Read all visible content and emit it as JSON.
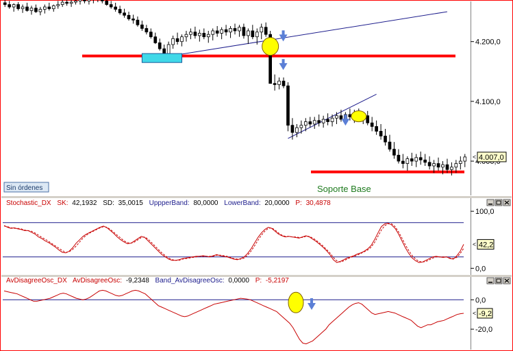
{
  "chart_data": [
    {
      "type": "candlestick",
      "panel": "price",
      "y_ticks": [
        "4.200,0",
        "4.100,0",
        "4.000,0"
      ],
      "y_tick_values": [
        4200,
        4100,
        4000
      ],
      "ylim": [
        3945,
        4265
      ],
      "last_value_label": "4.007,0",
      "last_value": 4007,
      "status_label": "Sin órdenes",
      "annotation_label": "Soporte Base",
      "support_levels": [
        4176,
        3982
      ],
      "colors": {
        "up": "#ffffff",
        "down": "#000000",
        "support": "#ff0000",
        "trend": "#1c1c8c",
        "highlight": "#ffff00",
        "marker": "#5b7fd6"
      },
      "candles": [
        [
          4265,
          4270,
          4258,
          4262
        ],
        [
          4262,
          4268,
          4255,
          4258
        ],
        [
          4258,
          4264,
          4250,
          4262
        ],
        [
          4262,
          4266,
          4252,
          4255
        ],
        [
          4255,
          4262,
          4248,
          4258
        ],
        [
          4258,
          4265,
          4250,
          4252
        ],
        [
          4252,
          4260,
          4245,
          4256
        ],
        [
          4256,
          4262,
          4248,
          4250
        ],
        [
          4250,
          4258,
          4244,
          4254
        ],
        [
          4254,
          4262,
          4247,
          4258
        ],
        [
          4258,
          4265,
          4252,
          4255
        ],
        [
          4255,
          4262,
          4250,
          4260
        ],
        [
          4260,
          4268,
          4255,
          4262
        ],
        [
          4262,
          4270,
          4258,
          4266
        ],
        [
          4266,
          4272,
          4260,
          4264
        ],
        [
          4264,
          4270,
          4258,
          4266
        ],
        [
          4266,
          4272,
          4262,
          4268
        ],
        [
          4268,
          4275,
          4262,
          4270
        ],
        [
          4270,
          4276,
          4264,
          4268
        ],
        [
          4268,
          4274,
          4262,
          4270
        ],
        [
          4270,
          4276,
          4264,
          4272
        ],
        [
          4272,
          4278,
          4266,
          4270
        ],
        [
          4270,
          4276,
          4264,
          4268
        ],
        [
          4268,
          4274,
          4260,
          4262
        ],
        [
          4262,
          4268,
          4255,
          4258
        ],
        [
          4258,
          4265,
          4250,
          4254
        ],
        [
          4254,
          4260,
          4245,
          4248
        ],
        [
          4248,
          4255,
          4240,
          4244
        ],
        [
          4244,
          4250,
          4235,
          4238
        ],
        [
          4238,
          4245,
          4230,
          4236
        ],
        [
          4236,
          4242,
          4225,
          4228
        ],
        [
          4228,
          4235,
          4218,
          4222
        ],
        [
          4222,
          4228,
          4212,
          4216
        ],
        [
          4216,
          4222,
          4205,
          4208
        ],
        [
          4208,
          4215,
          4196,
          4198
        ],
        [
          4198,
          4205,
          4185,
          4188
        ],
        [
          4188,
          4195,
          4172,
          4180
        ],
        [
          4180,
          4200,
          4176,
          4195
        ],
        [
          4195,
          4210,
          4188,
          4205
        ],
        [
          4205,
          4215,
          4195,
          4200
        ],
        [
          4200,
          4212,
          4192,
          4208
        ],
        [
          4208,
          4218,
          4200,
          4212
        ],
        [
          4212,
          4222,
          4204,
          4216
        ],
        [
          4216,
          4225,
          4205,
          4210
        ],
        [
          4210,
          4220,
          4200,
          4214
        ],
        [
          4214,
          4222,
          4204,
          4208
        ],
        [
          4208,
          4218,
          4198,
          4212
        ],
        [
          4212,
          4222,
          4202,
          4218
        ],
        [
          4218,
          4226,
          4208,
          4214
        ],
        [
          4214,
          4224,
          4204,
          4220
        ],
        [
          4220,
          4228,
          4210,
          4216
        ],
        [
          4216,
          4226,
          4206,
          4222
        ],
        [
          4222,
          4230,
          4212,
          4218
        ],
        [
          4218,
          4228,
          4208,
          4224
        ],
        [
          4224,
          4230,
          4205,
          4210
        ],
        [
          4210,
          4222,
          4196,
          4218
        ],
        [
          4218,
          4228,
          4204,
          4208
        ],
        [
          4208,
          4222,
          4195,
          4216
        ],
        [
          4216,
          4230,
          4204,
          4224
        ],
        [
          4224,
          4232,
          4208,
          4212
        ],
        [
          4212,
          4218,
          4160,
          4130
        ],
        [
          4130,
          4145,
          4118,
          4128
        ],
        [
          4128,
          4140,
          4120,
          4134
        ],
        [
          4134,
          4140,
          4122,
          4126
        ],
        [
          4126,
          4132,
          4050,
          4060
        ],
        [
          4060,
          4072,
          4036,
          4048
        ],
        [
          4048,
          4062,
          4040,
          4056
        ],
        [
          4056,
          4068,
          4046,
          4060
        ],
        [
          4060,
          4072,
          4050,
          4066
        ],
        [
          4066,
          4074,
          4056,
          4062
        ],
        [
          4062,
          4074,
          4054,
          4068
        ],
        [
          4068,
          4078,
          4058,
          4064
        ],
        [
          4064,
          4076,
          4056,
          4070
        ],
        [
          4070,
          4080,
          4060,
          4066
        ],
        [
          4066,
          4078,
          4058,
          4072
        ],
        [
          4072,
          4082,
          4062,
          4076
        ],
        [
          4076,
          4086,
          4066,
          4070
        ],
        [
          4070,
          4082,
          4062,
          4078
        ],
        [
          4078,
          4088,
          4068,
          4074
        ],
        [
          4074,
          4086,
          4064,
          4080
        ],
        [
          4080,
          4088,
          4068,
          4072
        ],
        [
          4072,
          4082,
          4062,
          4076
        ],
        [
          4076,
          4084,
          4060,
          4064
        ],
        [
          4064,
          4074,
          4050,
          4058
        ],
        [
          4058,
          4068,
          4044,
          4050
        ],
        [
          4050,
          4062,
          4036,
          4042
        ],
        [
          4042,
          4054,
          4026,
          4032
        ],
        [
          4032,
          4044,
          4016,
          4020
        ],
        [
          4020,
          4032,
          4004,
          4010
        ],
        [
          4010,
          4020,
          3996,
          4000
        ],
        [
          4000,
          4012,
          3988,
          3996
        ],
        [
          3996,
          4008,
          3984,
          4004
        ],
        [
          4004,
          4014,
          3992,
          4000
        ],
        [
          4000,
          4012,
          3990,
          4006
        ],
        [
          4006,
          4016,
          3994,
          4002
        ],
        [
          4002,
          4012,
          3992,
          3998
        ],
        [
          3998,
          4008,
          3986,
          3992
        ],
        [
          3992,
          4002,
          3980,
          3996
        ],
        [
          3996,
          4006,
          3984,
          3990
        ],
        [
          3990,
          4000,
          3978,
          3994
        ],
        [
          3994,
          4004,
          3980,
          3986
        ],
        [
          3986,
          3998,
          3976,
          3990
        ],
        [
          3990,
          4002,
          3980,
          3996
        ],
        [
          3996,
          4008,
          3986,
          4000
        ],
        [
          4000,
          4012,
          3990,
          4007
        ]
      ]
    },
    {
      "type": "line",
      "panel": "stochastic",
      "header": {
        "name": "Stochastic_DX",
        "sk_label": "SK:",
        "sk_value": "42,1932",
        "sd_label": "SD:",
        "sd_value": "35,0015",
        "upper_label": "UppperBand:",
        "upper_value": "80,0000",
        "lower_label": "LowerBand:",
        "lower_value": "20,0000",
        "p_label": "P:",
        "p_value": "30,4878"
      },
      "y_ticks": [
        "100,0",
        "0,0"
      ],
      "y_tick_values": [
        100,
        0
      ],
      "ylim": [
        -8,
        105
      ],
      "bands": [
        80,
        20
      ],
      "last_value_label": "42,2",
      "colors": {
        "sk": "#c80000",
        "sd": "#c80000",
        "band": "#1c1c8c"
      },
      "series": [
        {
          "name": "SK",
          "values": [
            75,
            72,
            70,
            71,
            69,
            68,
            66,
            66,
            63,
            60,
            55,
            52,
            48,
            45,
            41,
            37,
            32,
            28,
            27,
            30,
            36,
            44,
            50,
            56,
            60,
            63,
            66,
            69,
            72,
            74,
            71,
            66,
            61,
            55,
            50,
            46,
            43,
            44,
            48,
            52,
            56,
            54,
            48,
            42,
            36,
            30,
            24,
            20,
            16,
            14,
            14,
            15,
            17,
            18,
            19,
            20,
            21,
            21,
            22,
            21,
            20,
            22,
            24,
            22,
            21,
            20,
            18,
            16,
            15,
            17,
            20,
            26,
            34,
            44,
            54,
            62,
            68,
            72,
            70,
            65,
            60,
            57,
            55,
            56,
            55,
            54,
            53,
            55,
            57,
            55,
            51,
            47,
            42,
            37,
            31,
            24,
            15,
            10,
            12,
            15,
            18,
            20,
            22,
            25,
            27,
            30,
            34,
            40,
            50,
            62,
            73,
            78,
            79,
            76,
            70,
            60,
            48,
            36,
            26,
            18,
            13,
            10,
            11,
            14,
            17,
            20,
            21,
            20,
            19,
            20,
            17,
            16,
            22,
            30,
            42
          ]
        },
        {
          "name": "SD",
          "values": [
            74,
            73,
            71,
            70,
            70,
            69,
            67,
            66,
            65,
            62,
            58,
            54,
            51,
            47,
            43,
            39,
            35,
            31,
            28,
            29,
            33,
            39,
            46,
            53,
            58,
            62,
            65,
            68,
            71,
            73,
            72,
            68,
            63,
            58,
            53,
            48,
            45,
            44,
            46,
            50,
            54,
            55,
            51,
            45,
            39,
            33,
            27,
            22,
            18,
            15,
            14,
            14,
            16,
            17,
            18,
            19,
            20,
            21,
            21,
            21,
            21,
            21,
            23,
            23,
            22,
            21,
            19,
            17,
            16,
            16,
            18,
            23,
            30,
            39,
            49,
            58,
            65,
            70,
            71,
            67,
            62,
            58,
            56,
            56,
            55,
            55,
            54,
            54,
            56,
            56,
            53,
            49,
            44,
            39,
            33,
            27,
            19,
            13,
            11,
            13,
            16,
            19,
            21,
            23,
            26,
            29,
            32,
            37,
            45,
            56,
            67,
            75,
            78,
            78,
            73,
            64,
            53,
            41,
            31,
            22,
            16,
            12,
            11,
            12,
            15,
            18,
            20,
            20,
            20,
            20,
            18,
            17,
            19,
            26,
            35
          ]
        }
      ]
    },
    {
      "type": "line",
      "panel": "oscillator",
      "header": {
        "name": "AvDisagreeOsc_DX",
        "osc_label": "AvDisagreeOsc:",
        "osc_value": "-9,2348",
        "band_label": "Band_AvDisagreeOsc:",
        "band_value": "0,0000",
        "p_label": "P:",
        "p_value": "-5,2197"
      },
      "y_ticks": [
        "0,0",
        "-20,0"
      ],
      "y_tick_values": [
        0,
        -20
      ],
      "ylim": [
        -33,
        9
      ],
      "bands": [
        0
      ],
      "last_value_label": "-9,2",
      "colors": {
        "osc": "#c80000",
        "band": "#1c1c8c",
        "highlight": "#ffff00",
        "marker": "#5b7fd6"
      },
      "series": [
        {
          "name": "AvDisagreeOsc",
          "values": [
            6,
            5.5,
            5,
            4.5,
            4,
            3,
            2,
            1,
            0,
            -1,
            -1,
            -0.5,
            0,
            0.5,
            1,
            2,
            3,
            4,
            4.5,
            4,
            3,
            2,
            1,
            0.5,
            0,
            0.5,
            1.5,
            3,
            4.5,
            6,
            6.5,
            6,
            5,
            4,
            3,
            2.5,
            3,
            4,
            5,
            6,
            6.5,
            6,
            5,
            4,
            2,
            0,
            -2,
            -4,
            -5,
            -6,
            -7,
            -8,
            -9,
            -10,
            -11,
            -11.5,
            -11,
            -10,
            -9,
            -8,
            -7,
            -6,
            -5,
            -4,
            -3,
            -2.5,
            -2,
            -1.5,
            -1,
            -0.5,
            0,
            0.5,
            1,
            0.8,
            0.5,
            0,
            -1,
            -2,
            -3,
            -4,
            -5,
            -6,
            -7,
            -8,
            -10,
            -12,
            -14,
            -16,
            -19,
            -23,
            -27,
            -29.5,
            -30,
            -29,
            -28,
            -26,
            -24,
            -22,
            -20,
            -17,
            -15,
            -13,
            -11,
            -9,
            -7,
            -5,
            -3.5,
            -2.5,
            -2,
            -3,
            -5,
            -7,
            -9,
            -10,
            -9.5,
            -9,
            -8.5,
            -8,
            -8.5,
            -9,
            -10,
            -11,
            -12,
            -13,
            -14,
            -16,
            -18,
            -19,
            -18,
            -17,
            -17,
            -16,
            -15,
            -14.5,
            -14,
            -13,
            -12,
            -11,
            -10,
            -9.5,
            -9.2
          ]
        }
      ]
    }
  ]
}
